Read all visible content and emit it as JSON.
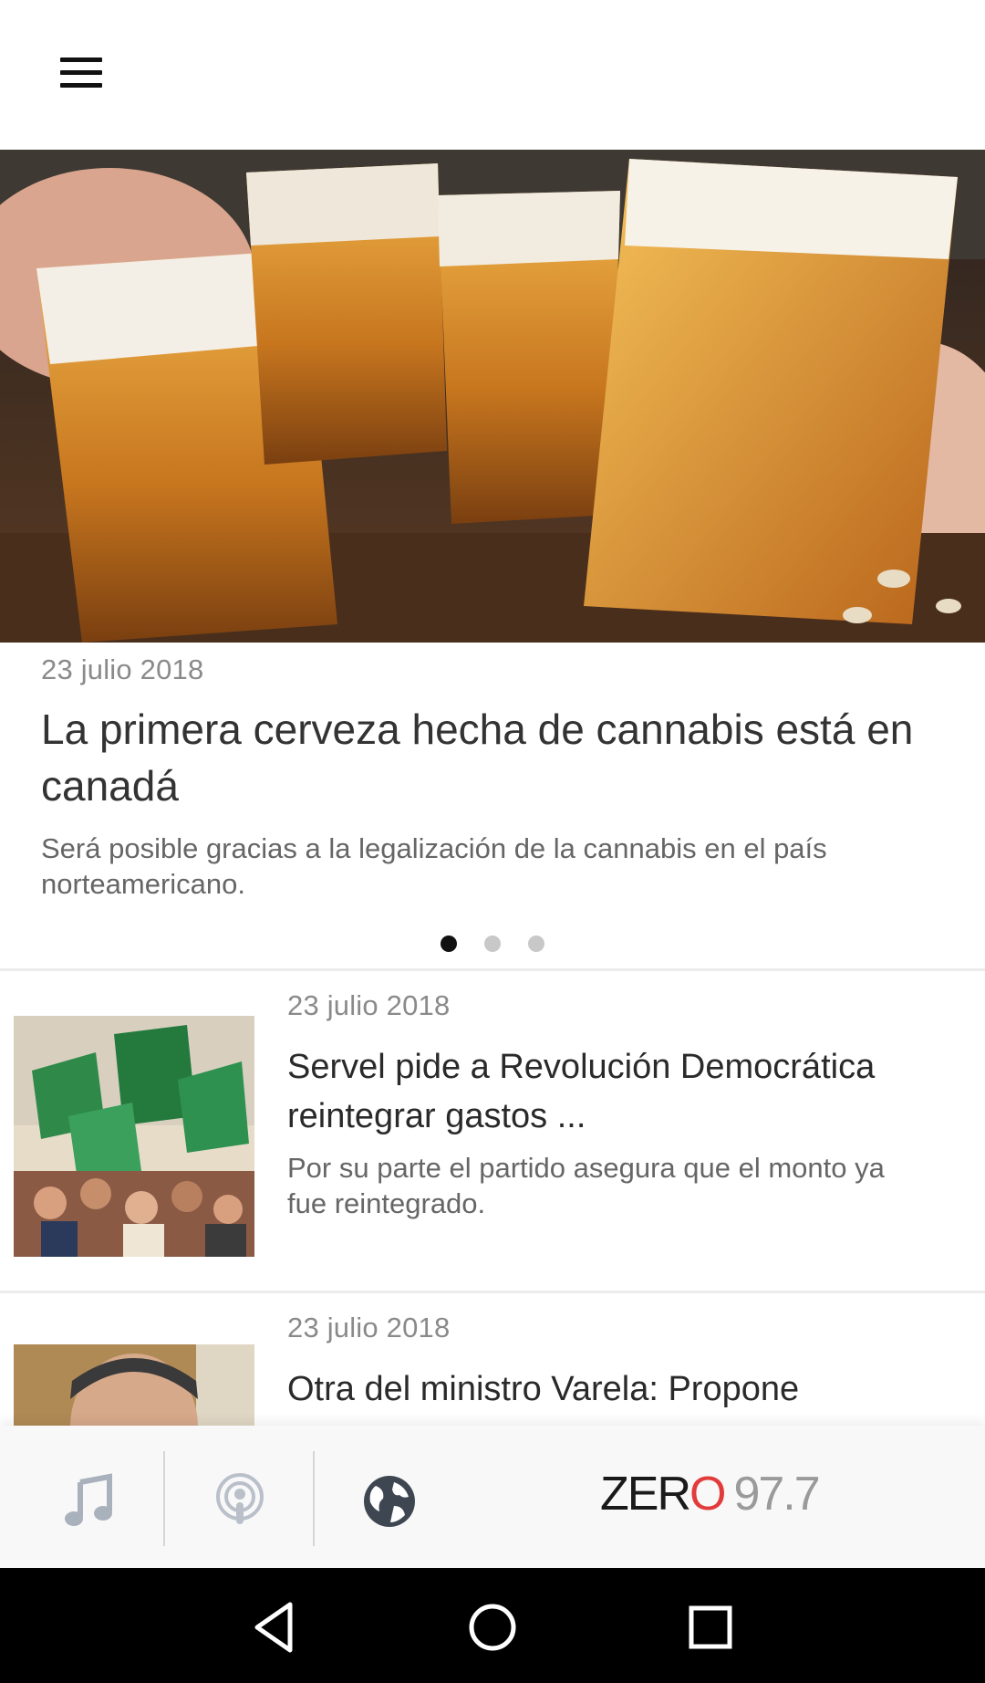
{
  "header": {
    "menu_icon": "hamburger-menu-icon"
  },
  "hero": {
    "date": "23 julio 2018",
    "title": "La primera cerveza hecha de cannabis está en canadá",
    "subtitle": "Será posible gracias a la legalización de la cannabis en el país norteamericano.",
    "carousel_count": 3,
    "carousel_active": 0
  },
  "articles": [
    {
      "date": "23 julio 2018",
      "title": "Servel pide a Revolución Democrática reintegrar gastos ...",
      "subtitle": "Por su parte el partido asegura que el monto ya fue reintegrado."
    },
    {
      "date": "23 julio 2018",
      "title": "Otra del ministro Varela: Propone",
      "subtitle": ""
    }
  ],
  "bottom_nav": {
    "items": [
      "music-note-icon",
      "podcast-icon",
      "globe-icon"
    ],
    "brand_zero": "ZER",
    "brand_o": "O",
    "brand_freq": "97.7"
  },
  "system_nav": [
    "back-icon",
    "home-icon",
    "recents-icon"
  ],
  "colors": {
    "brand_red": "#e23b3b",
    "active_dot": "#111111",
    "inactive_dot": "#c8c8c8"
  }
}
